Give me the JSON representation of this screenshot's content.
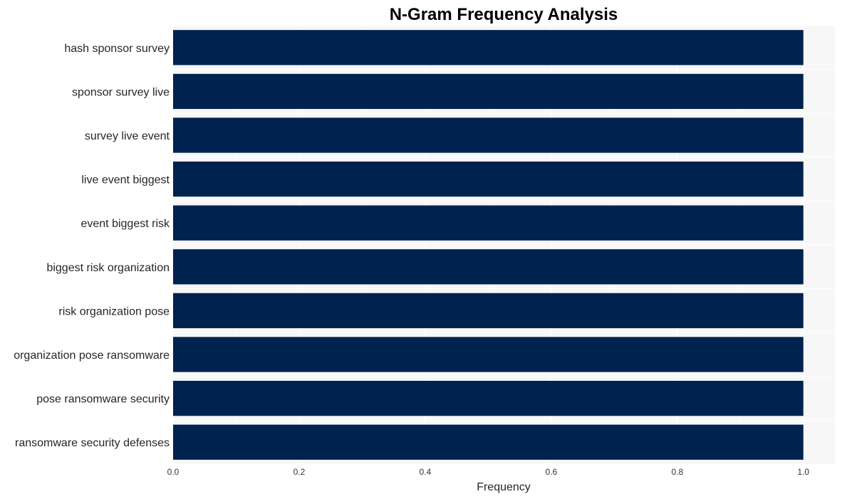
{
  "chart_data": {
    "type": "bar",
    "orientation": "horizontal",
    "title": "N-Gram Frequency Analysis",
    "xlabel": "Frequency",
    "ylabel": "",
    "categories": [
      "hash sponsor survey",
      "sponsor survey live",
      "survey live event",
      "live event biggest",
      "event biggest risk",
      "biggest risk organization",
      "risk organization pose",
      "organization pose ransomware",
      "pose ransomware security",
      "ransomware security defenses"
    ],
    "values": [
      1,
      1,
      1,
      1,
      1,
      1,
      1,
      1,
      1,
      1
    ],
    "xlim": [
      0,
      1.05
    ],
    "xticks": [
      "0.0",
      "0.2",
      "0.4",
      "0.6",
      "0.8",
      "1.0"
    ],
    "xtick_values": [
      0,
      0.2,
      0.4,
      0.6,
      0.8,
      1.0
    ],
    "grid": true,
    "legend": "none",
    "colors": {
      "bar": "#00224e",
      "plot_background": "#f7f7f7",
      "grid": "#ffffff"
    }
  }
}
